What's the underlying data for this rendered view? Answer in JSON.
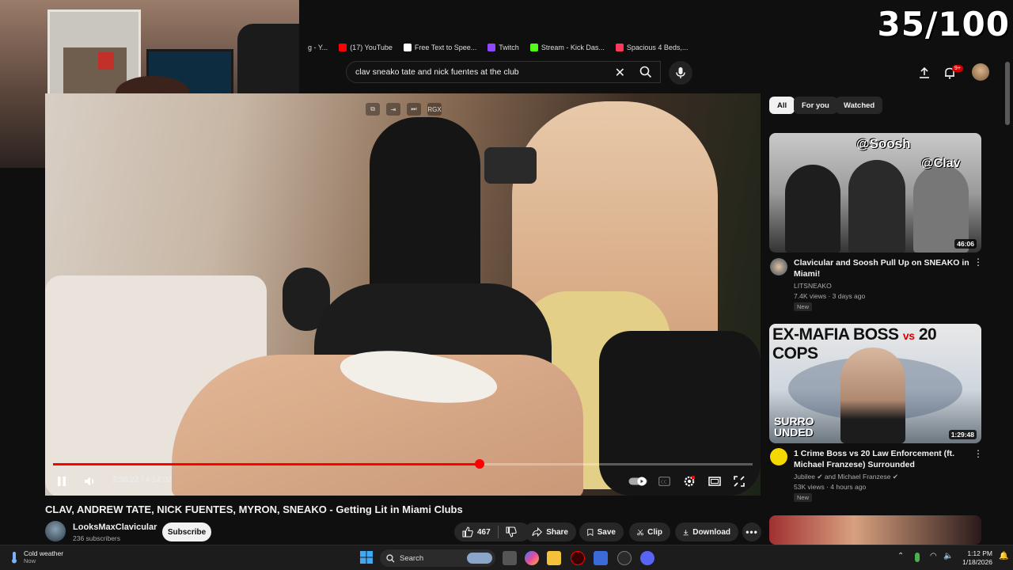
{
  "overlay": {
    "counter": "35/100"
  },
  "bookmarks": [
    {
      "label": "g - Y...",
      "color": "#666666"
    },
    {
      "label": "(17) YouTube",
      "color": "#ff0000"
    },
    {
      "label": "Free Text to Spee...",
      "color": "#ffffff"
    },
    {
      "label": "Twitch",
      "color": "#9146ff"
    },
    {
      "label": "Stream - Kick Das...",
      "color": "#53fc18"
    },
    {
      "label": "Spacious 4 Beds,...",
      "color": "#ff385c"
    }
  ],
  "header": {
    "search_query": "clav sneako tate and nick fuentes at the club",
    "notif_count": "9+"
  },
  "player": {
    "current_time": "2:35:22",
    "separator": "/",
    "duration": "4:14:02",
    "progress_fraction": 0.6096,
    "mini_label": "RGX"
  },
  "video": {
    "title": "CLAV, ANDREW TATE, NICK FUENTES, MYRON, SNEAKO - Getting Lit in Miami Clubs",
    "channel": "LooksMaxClavicular",
    "subscribers": "236 subscribers",
    "subscribe_label": "Subscribe",
    "likes": "467",
    "share_label": "Share",
    "save_label": "Save",
    "clip_label": "Clip",
    "download_label": "Download"
  },
  "filters": [
    "All",
    "For you",
    "Watched"
  ],
  "recommendations": [
    {
      "title": "Clavicular and Soosh Pull Up on SNEAKO in Miami!",
      "channel": "LITSNEAKO",
      "meta": "7.4K views · 3 days ago",
      "badge": "New",
      "duration": "46:06",
      "thumb_text_1": "@Soosh",
      "thumb_text_2": "@Clav"
    },
    {
      "title": "1 Crime Boss vs 20 Law Enforcement (ft. Michael Franzese) Surrounded",
      "channel": "Jubilee",
      "channel_extra": "and Michael Franzese",
      "meta": "53K views · 4 hours ago",
      "badge": "New",
      "duration": "1:29:48",
      "thumb_text_1": "EX-MAFIA BOSS",
      "thumb_text_vs": "vs",
      "thumb_text_2": "20 COPS",
      "thumb_text_3": "SURRO",
      "thumb_text_4": "UNDED"
    }
  ],
  "taskbar": {
    "weather_title": "Cold weather",
    "weather_sub": "Now",
    "search_label": "Search",
    "time": "1:12 PM",
    "date": "1/18/2026"
  }
}
